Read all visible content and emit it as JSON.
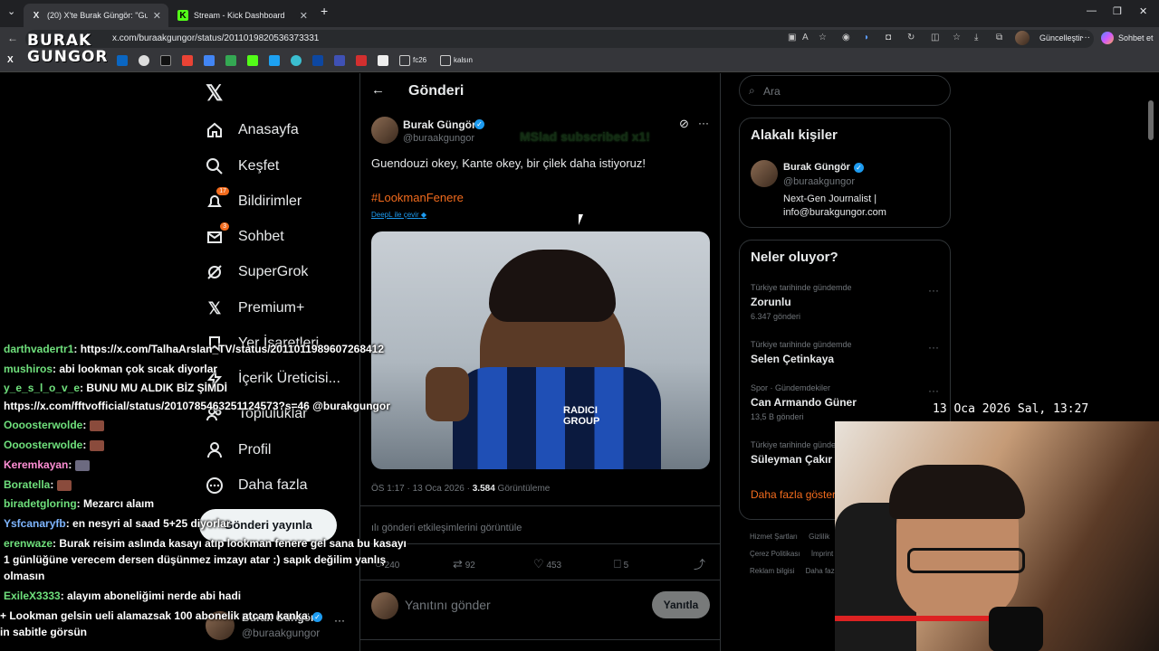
{
  "browser": {
    "tabs": [
      {
        "label": "(20) X'te Burak Güngör: \"Guendou",
        "active": true,
        "favicon": "X"
      },
      {
        "label": "Stream - Kick Dashboard",
        "active": false,
        "favicon": "K"
      }
    ],
    "url": "x.com/buraakgungor/status/2011019820536373331",
    "update_label": "Güncelleştir",
    "chat_label": "Sohbet et",
    "bookmarks": [
      "fc26",
      "kalsın"
    ]
  },
  "nav": {
    "items": [
      {
        "label": "Anasayfa",
        "icon": "home-icon"
      },
      {
        "label": "Keşfet",
        "icon": "search-icon"
      },
      {
        "label": "Bildirimler",
        "icon": "bell-icon",
        "badge": "17"
      },
      {
        "label": "Sohbet",
        "icon": "mail-icon",
        "badge": "3"
      },
      {
        "label": "SuperGrok",
        "icon": "grok-icon"
      },
      {
        "label": "Premium+",
        "icon": "x-logo-icon"
      },
      {
        "label": "Yer İşaretleri",
        "icon": "bookmark-icon"
      },
      {
        "label": "İçerik Üreticisi...",
        "icon": "lightning-icon"
      },
      {
        "label": "Topluluklar",
        "icon": "people-icon"
      },
      {
        "label": "Profil",
        "icon": "person-icon"
      },
      {
        "label": "Daha fazla",
        "icon": "more-circle-icon"
      }
    ],
    "post_button": "Gönderi yayınla",
    "account": {
      "name": "Burak Güngör",
      "handle": "@buraakgungor"
    }
  },
  "post": {
    "header": "Gönderi",
    "author": "Burak Güngör",
    "handle": "@buraakgungor",
    "text": "Guendouzi okey, Kante okey, bir çilek daha istiyoruz!",
    "hashtag": "#LookmanFenere",
    "translate": "DeepL ile çevir",
    "time": "ÖS 1:17 · 13 Oca 2026 · ",
    "views_count": "3.584",
    "views_label": " Görüntüleme",
    "engagements": "gönderi etkileşimlerini görüntüle",
    "replies": "240",
    "reposts": "92",
    "likes": "453",
    "bookmarks": "5",
    "reply_placeholder": "Yanıtını gönder",
    "reply_button": "Yanıtla",
    "overlay_sub": "MSlad subscribed x1!",
    "jersey_text": "RADICI GROUP"
  },
  "sidebar": {
    "search_placeholder": "Ara",
    "related_title": "Alakalı kişiler",
    "related": {
      "name": "Burak Güngör",
      "handle": "@buraakgungor",
      "bio": "Next-Gen Journalist | info@burakgungor.com"
    },
    "trends_title": "Neler oluyor?",
    "trends": [
      {
        "category": "Türkiye tarihinde gündemde",
        "name": "Zorunlu",
        "count": "6.347 gönderi"
      },
      {
        "category": "Türkiye tarihinde gündemde",
        "name": "Selen Çetinkaya",
        "count": ""
      },
      {
        "category": "Spor · Gündemdekiler",
        "name": "Can Armando Güner",
        "count": "13,5 B gönderi"
      },
      {
        "category": "Türkiye tarihinde gündem",
        "name": "Süleyman Çakır",
        "count": ""
      }
    ],
    "show_more": "Daha fazla göster",
    "footer": [
      "Hizmet Şartları",
      "Gizlilik",
      "Çerez Politikası",
      "İmprint",
      "Reklam bilgisi",
      "Daha fazla"
    ]
  },
  "overlay": {
    "logo_line1": "BURAK",
    "logo_line2": "GUNGOR",
    "clock": "13 Oca 2026 Sal, 13:27",
    "chat": [
      {
        "user": "darthvadertr1",
        "msg": ": https://x.com/TalhaArslan_TV/status/2011011989607268412"
      },
      {
        "user": "mushiros",
        "msg": ": abi lookman çok sıcak diyorlar"
      },
      {
        "user": "y_e_s_l_o_v_e",
        "msg": ": BUNU MU ALDIK BİZ ŞİMDİ"
      },
      {
        "user": "",
        "msg": "https://x.com/fftvofficial/status/2010785463251124573?s=46 @burakgungor"
      },
      {
        "user": "Oooosterwolde",
        "msg": ":"
      },
      {
        "user": "Oooosterwolde",
        "msg": ":"
      },
      {
        "user": "Keremkayan",
        "msg": ":"
      },
      {
        "user": "Boratella",
        "msg": ":"
      },
      {
        "user": "biradetgloring",
        "msg": ": Mezarcı alaım"
      },
      {
        "user": "Ysfcanaryfb",
        "msg": ": en nesyri al saad 5+25 diyorlar"
      },
      {
        "user": "erenwaze",
        "msg": ": Burak reisim aslında kasayı atıp lookman fenere gel sana bu kasayı"
      },
      {
        "user": "",
        "msg": "1 günlüğüne verecem dersen düşünmez imzayı atar :) sapık değilim yanlış"
      },
      {
        "user": "",
        "msg": "olmasın"
      },
      {
        "user": "ExileX3333",
        "msg": ": alayım aboneliğimi nerde abi hadi"
      },
      {
        "user": "",
        "msg": "+ Lookman gelsin ueli alamazsak 100 abonelik atcam kanka"
      },
      {
        "user": "",
        "msg": "in sabitle görsün"
      }
    ]
  }
}
